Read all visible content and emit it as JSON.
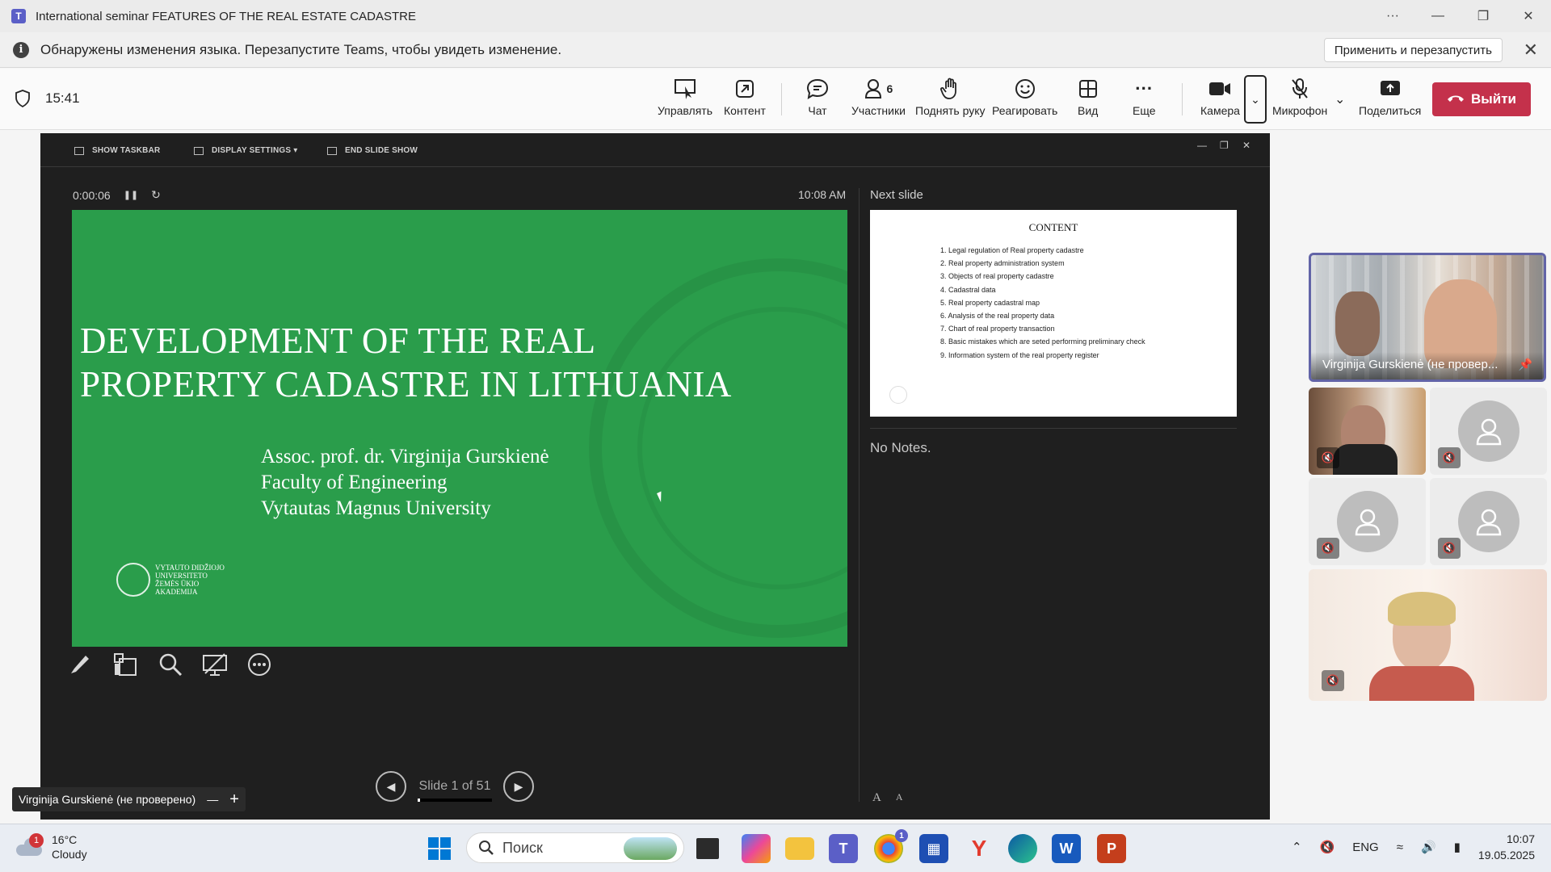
{
  "window": {
    "title": "International seminar FEATURES OF THE REAL ESTATE CADASTRE",
    "more": "···"
  },
  "infobar": {
    "message": "Обнаружены изменения языка. Перезапустите Teams, чтобы увидеть изменение.",
    "restart_label": "Применить и перезапустить"
  },
  "meeting": {
    "time": "15:41",
    "toolbar": {
      "manage": "Управлять",
      "content": "Контент",
      "chat": "Чат",
      "participants": "Участники",
      "participants_count": "6",
      "raise_hand": "Поднять руку",
      "react": "Реагировать",
      "view": "Вид",
      "more": "Еще",
      "camera": "Камера",
      "mic": "Микрофон",
      "share": "Поделиться"
    },
    "leave_label": "Выйти"
  },
  "presenter": {
    "tools": {
      "taskbar": "SHOW TASKBAR",
      "display": "DISPLAY SETTINGS ▾",
      "end": "END SLIDE SHOW"
    },
    "timer": "0:00:06",
    "clock": "10:08 AM",
    "next_label": "Next slide",
    "notes": "No Notes.",
    "slide_counter": "Slide 1 of 51",
    "slide": {
      "title_line1": "DEVELOPMENT OF THE REAL",
      "title_line2": "PROPERTY CADASTRE IN LITHUANIA",
      "author": "Assoc. prof. dr. Virginija Gurskienė",
      "faculty": "Faculty of Engineering",
      "university": "Vytautas Magnus University",
      "logo_text1": "VYTAUTO DIDŽIOJO",
      "logo_text2": "UNIVERSITETO",
      "logo_text3": "ŽEMĖS ŪKIO",
      "logo_text4": "AKADEMIJA"
    },
    "next_slide": {
      "title": "CONTENT",
      "items": [
        "1. Legal regulation of Real property cadastre",
        "2. Real property administration system",
        "3. Objects of real property cadastre",
        "4. Cadastral data",
        "5. Real property cadastral map",
        "6. Analysis of the real property data",
        "7. Chart of real property transaction",
        "8. Basic mistakes which are seted performing preliminary check",
        "9. Information system of the real property register"
      ]
    },
    "font_buttons": [
      "A",
      "A"
    ]
  },
  "name_badge": "Virginija Gurskienė (не проверено)",
  "participants": {
    "pinned_name": "Virginija Gurskienė (не провер..."
  },
  "taskbar": {
    "weather_temp": "16°C",
    "weather_desc": "Cloudy",
    "weather_badge": "1",
    "search_placeholder": "Поиск",
    "lang": "ENG",
    "time": "10:07",
    "date": "19.05.2025",
    "chrome_badge": "1"
  }
}
